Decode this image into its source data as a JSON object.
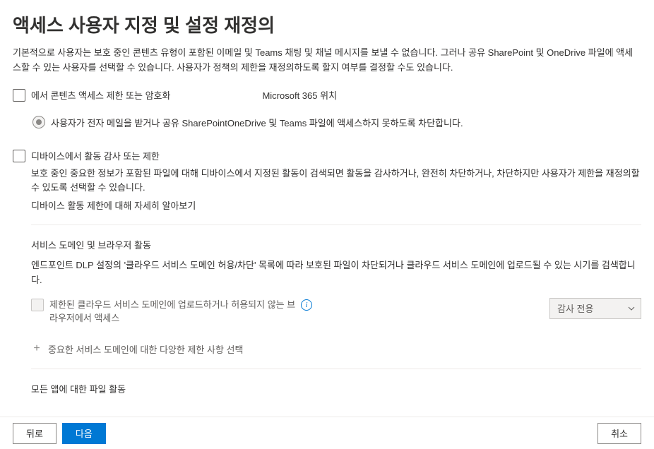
{
  "title": "액세스 사용자 지정 및 설정 재정의",
  "description": "기본적으로 사용자는 보호 중인 콘텐츠 유형이 포함된 이메일 및 Teams 채팅 및 채널 메시지를 보낼 수 없습니다. 그러나 공유 SharePoint 및 OneDrive 파일에 액세스할 수 있는 사용자를 선택할 수 있습니다. 사용자가 정책의 제한을 재정의하도록 할지 여부를 결정할 수도 있습니다.",
  "restrict_access": {
    "label": "에서 콘텐츠 액세스 제한 또는 암호화",
    "location": "Microsoft 365 위치",
    "radio_label": "사용자가 전자 메일을 받거나 공유 SharePointOneDrive 및 Teams 파일에 액세스하지 못하도록 차단합니다."
  },
  "device_audit": {
    "label": "디바이스에서 활동 감사 또는 제한",
    "description": "보호 중인 중요한 정보가 포함된 파일에 대해 디바이스에서 지정된 활동이 검색되면 활동을 감사하거나, 완전히 차단하거나, 차단하지만 사용자가 제한을 재정의할 수 있도록 선택할 수 있습니다.",
    "learn_more": "디바이스 활동 제한에 대해 자세히 알아보기"
  },
  "service_domains": {
    "title": "서비스 도메인 및 브라우저 활동",
    "description": "엔드포인트 DLP 설정의 '클라우드 서비스 도메인 허용/차단' 목록에 따라 보호된 파일이 차단되거나 클라우드 서비스 도메인에 업로드될 수 있는 시기를 검색합니다.",
    "upload_label": "제한된 클라우드 서비스 도메인에 업로드하거나 허용되지 않는 브라우저에서 액세스",
    "dropdown_value": "감사 전용",
    "add_label": "중요한 서비스 도메인에 대한 다양한 제한 사항 선택"
  },
  "all_apps": {
    "title": "모든 앱에 대한 파일 활동"
  },
  "footer": {
    "back": "뒤로",
    "next": "다음",
    "cancel": "취소"
  }
}
